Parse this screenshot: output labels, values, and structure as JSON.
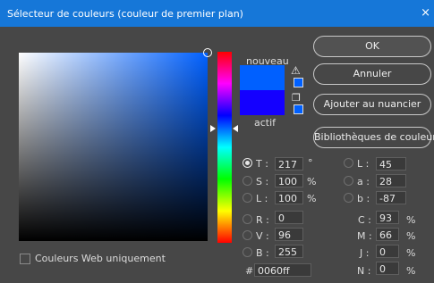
{
  "window": {
    "title": "Sélecteur de couleurs (couleur de premier plan)",
    "close_glyph": "×"
  },
  "preview": {
    "new_label": "nouveau",
    "current_label": "actif",
    "new_color": "#0060ff",
    "current_color": "#1400ff"
  },
  "icons": {
    "warning": "warning-icon",
    "cube": "web-safe-cube-icon"
  },
  "buttons": {
    "ok": "OK",
    "cancel": "Annuler",
    "add_swatch": "Ajouter au nuancier",
    "libraries": "Bibliothèques de couleurs"
  },
  "hsb": {
    "h": {
      "label": "T :",
      "value": "217",
      "unit": "°"
    },
    "s": {
      "label": "S :",
      "value": "100",
      "unit": "%"
    },
    "b": {
      "label": "L :",
      "value": "100",
      "unit": "%"
    }
  },
  "rgb": {
    "r": {
      "label": "R :",
      "value": "0"
    },
    "g": {
      "label": "V :",
      "value": "96"
    },
    "b": {
      "label": "B :",
      "value": "255"
    }
  },
  "lab": {
    "l": {
      "label": "L :",
      "value": "45"
    },
    "a": {
      "label": "a :",
      "value": "28"
    },
    "b": {
      "label": "b :",
      "value": "-87"
    }
  },
  "cmyk": {
    "c": {
      "label": "C :",
      "value": "93",
      "unit": "%"
    },
    "m": {
      "label": "M :",
      "value": "66",
      "unit": "%"
    },
    "y": {
      "label": "J :",
      "value": "0",
      "unit": "%"
    },
    "k": {
      "label": "N :",
      "value": "0",
      "unit": "%"
    }
  },
  "hex": {
    "label": "#",
    "value": "0060ff"
  },
  "web_only": {
    "label": "Couleurs Web uniquement",
    "checked": false
  }
}
